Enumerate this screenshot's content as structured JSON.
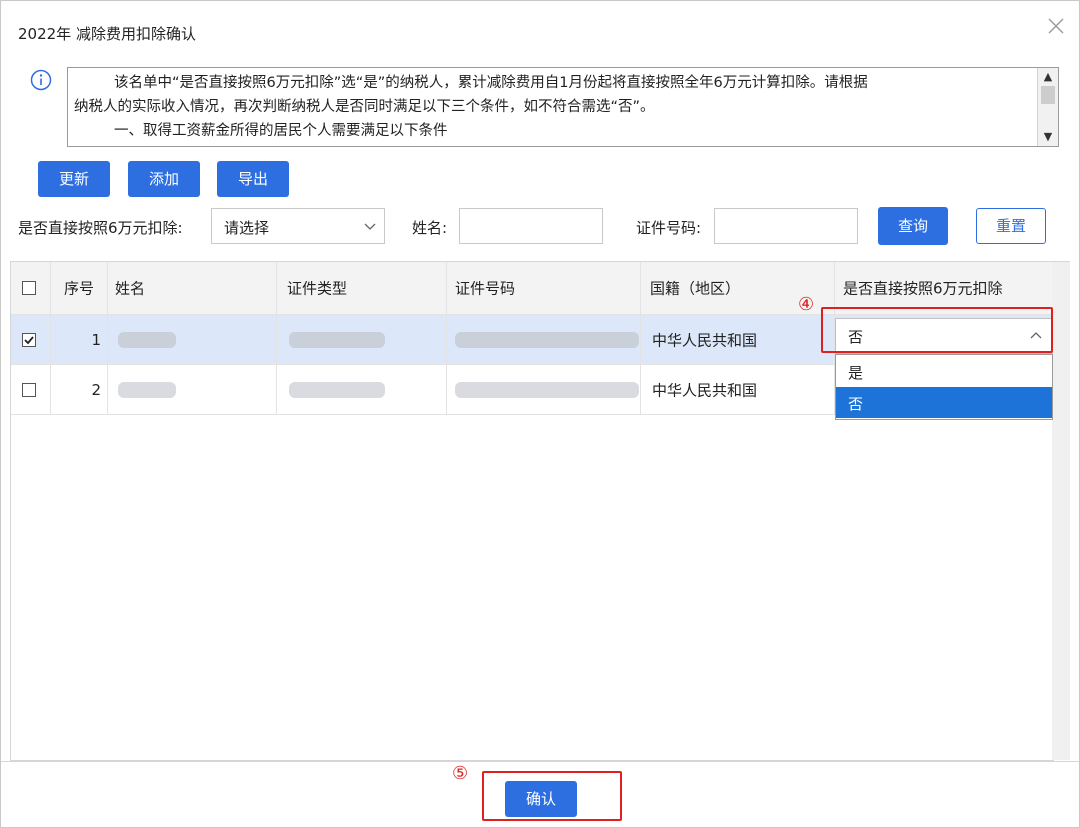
{
  "dialog": {
    "title": "2022年 减除费用扣除确认"
  },
  "notice": {
    "lines": [
      "该名单中“是否直接按照6万元扣除”选“是”的纳税人，累计减除费用自1月份起将直接按照全年6万元计算扣除。请根据",
      "纳税人的实际收入情况，再次判断纳税人是否同时满足以下三个条件，如不符合需选“否”。",
      "一、取得工资薪金所得的居民个人需要满足以下条件"
    ]
  },
  "toolbar": {
    "update": "更新",
    "add": "添加",
    "export": "导出"
  },
  "filters": {
    "deduct_label": "是否直接按照6万元扣除:",
    "deduct_value": "请选择",
    "name_label": "姓名:",
    "id_label": "证件号码:",
    "query": "查询",
    "reset": "重置"
  },
  "table": {
    "headers": {
      "seq": "序号",
      "name": "姓名",
      "id_type": "证件类型",
      "id_no": "证件号码",
      "nation": "国籍（地区）",
      "deduct": "是否直接按照6万元扣除"
    },
    "rows": [
      {
        "seq": "1",
        "checked": true,
        "nation": "中华人民共和国",
        "deduct": "否"
      },
      {
        "seq": "2",
        "checked": false,
        "nation": "中华人民共和国",
        "deduct": ""
      }
    ]
  },
  "dropdown": {
    "value": "否",
    "options": [
      "是",
      "否"
    ],
    "selected": "否"
  },
  "annotations": {
    "step4": "④",
    "step5": "⑤"
  },
  "footer": {
    "confirm": "确认"
  },
  "colors": {
    "primary": "#2d6fe0",
    "selected_row": "#dce8f9",
    "highlight": "#e02020"
  }
}
